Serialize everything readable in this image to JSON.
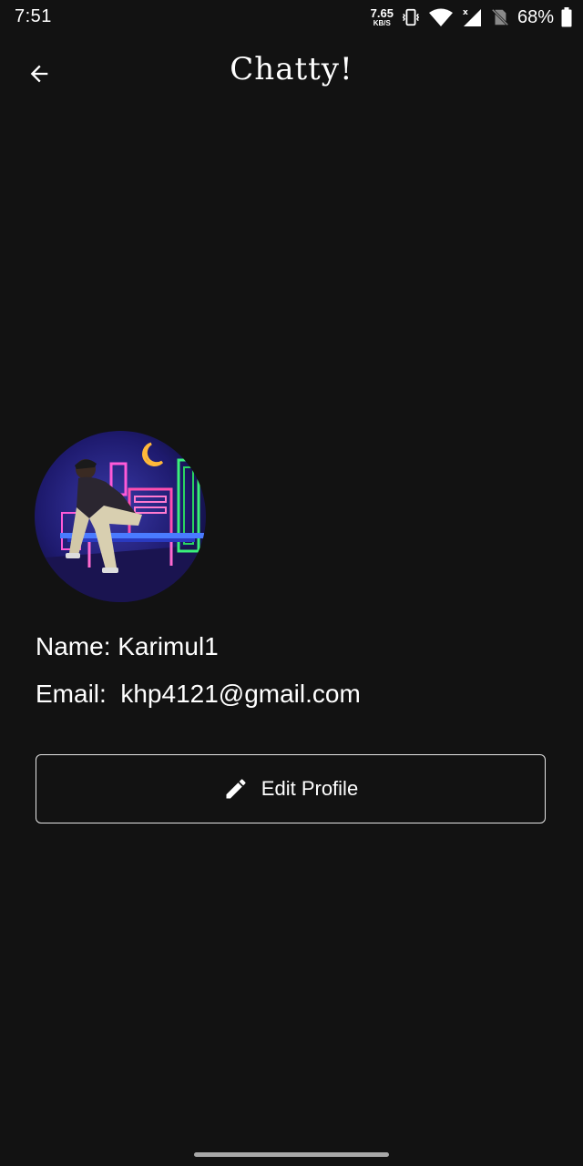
{
  "status_bar": {
    "time": "7:51",
    "net_speed_value": "7.65",
    "net_speed_unit": "KB/S",
    "battery_percent": "68%",
    "icons": [
      "vibrate-icon",
      "wifi-icon",
      "cell-signal-icon",
      "no-sim-icon",
      "battery-icon"
    ]
  },
  "app_bar": {
    "title": "Chatty!",
    "back_icon": "arrow-back-icon"
  },
  "profile": {
    "name_line": "Name: Karimul1",
    "email_line": "Email:  khp4121@gmail.com"
  },
  "edit_button": {
    "label": "Edit Profile",
    "icon": "pencil-icon"
  },
  "colors": {
    "background": "#121212",
    "text": "#ffffff",
    "button_border": "#e6e6e6",
    "nav_handle": "#a8a8a8"
  }
}
